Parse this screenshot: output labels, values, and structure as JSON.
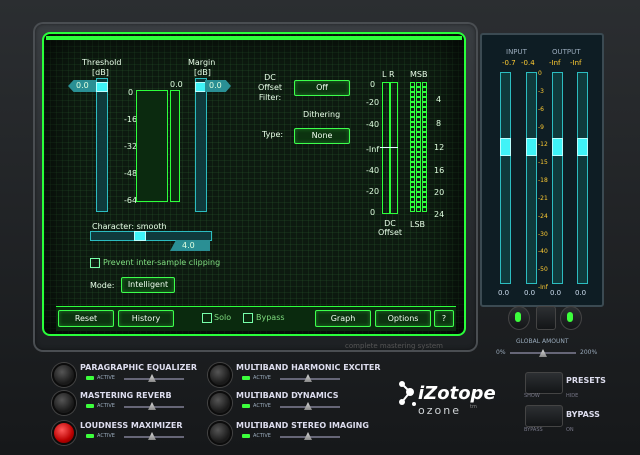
{
  "screen": {
    "threshold_label": "Threshold",
    "threshold_unit": "[dB]",
    "threshold_value": "0.0",
    "margin_label": "Margin",
    "margin_unit": "[dB]",
    "margin_value": "0.0",
    "mid_value": "0.0",
    "scale": [
      "0",
      "-16",
      "-32",
      "-48",
      "-64"
    ],
    "character_label": "Character: smooth",
    "character_value": "4.0",
    "prevent_clipping_label": "Prevent inter-sample clipping",
    "mode_label": "Mode:",
    "mode_value": "Intelligent",
    "dc_offset_label": "DC\nOffset\nFilter:",
    "dc_offset_value": "Off",
    "dithering_label": "Dithering",
    "type_label": "Type:",
    "type_value": "None",
    "lr_label": "L R",
    "dc_scale": [
      "0",
      "-20",
      "-40",
      "-Inf",
      "-40",
      "-20",
      "0"
    ],
    "msb_label": "MSB",
    "lsb_label": "LSB",
    "bit_scale": [
      "4",
      "8",
      "12",
      "16",
      "20",
      "24"
    ],
    "dc_offset_footer": "DC\nOffset",
    "reset": "Reset",
    "history": "History",
    "solo": "Solo",
    "bypass": "Bypass",
    "graph": "Graph",
    "options": "Options",
    "help": "?",
    "subtitle": "complete mastering system"
  },
  "meters": {
    "input_label": "INPUT",
    "output_label": "OUTPUT",
    "input_l": "-0.7",
    "input_r": "-0.4",
    "output_l": "-Inf",
    "output_r": "-Inf",
    "scale": [
      "0",
      "-3",
      "-6",
      "-9",
      "-12",
      "-15",
      "-18",
      "-21",
      "-24",
      "-30",
      "-40",
      "-50",
      "-Inf"
    ],
    "bottom_values": [
      "0.0",
      "0.0",
      "0.0",
      "0.0"
    ],
    "global_amount_label": "GLOBAL AMOUNT",
    "global_min": "0%",
    "global_max": "200%"
  },
  "modules": [
    {
      "name": "PARAGRAPHIC EQUALIZER",
      "active": "ACTIVE",
      "lit": false
    },
    {
      "name": "MASTERING REVERB",
      "active": "ACTIVE",
      "lit": false
    },
    {
      "name": "LOUDNESS MAXIMIZER",
      "active": "ACTIVE",
      "lit": true
    },
    {
      "name": "MULTIBAND HARMONIC EXCITER",
      "active": "ACTIVE",
      "lit": false
    },
    {
      "name": "MULTIBAND DYNAMICS",
      "active": "ACTIVE",
      "lit": false
    },
    {
      "name": "MULTIBAND STEREO IMAGING",
      "active": "ACTIVE",
      "lit": false
    }
  ],
  "brand": {
    "name": "iZotope",
    "product": "ozone",
    "tm": "tm"
  },
  "presets": {
    "label": "PRESETS",
    "show": "SHOW",
    "hide": "HIDE"
  },
  "bypass_hw": {
    "label": "BYPASS",
    "bypass": "BYPASS",
    "on": "ON"
  },
  "colors": {
    "accent": "#2dff3c",
    "meter": "#2fd8dc",
    "led_red": "#ff2a2a"
  }
}
